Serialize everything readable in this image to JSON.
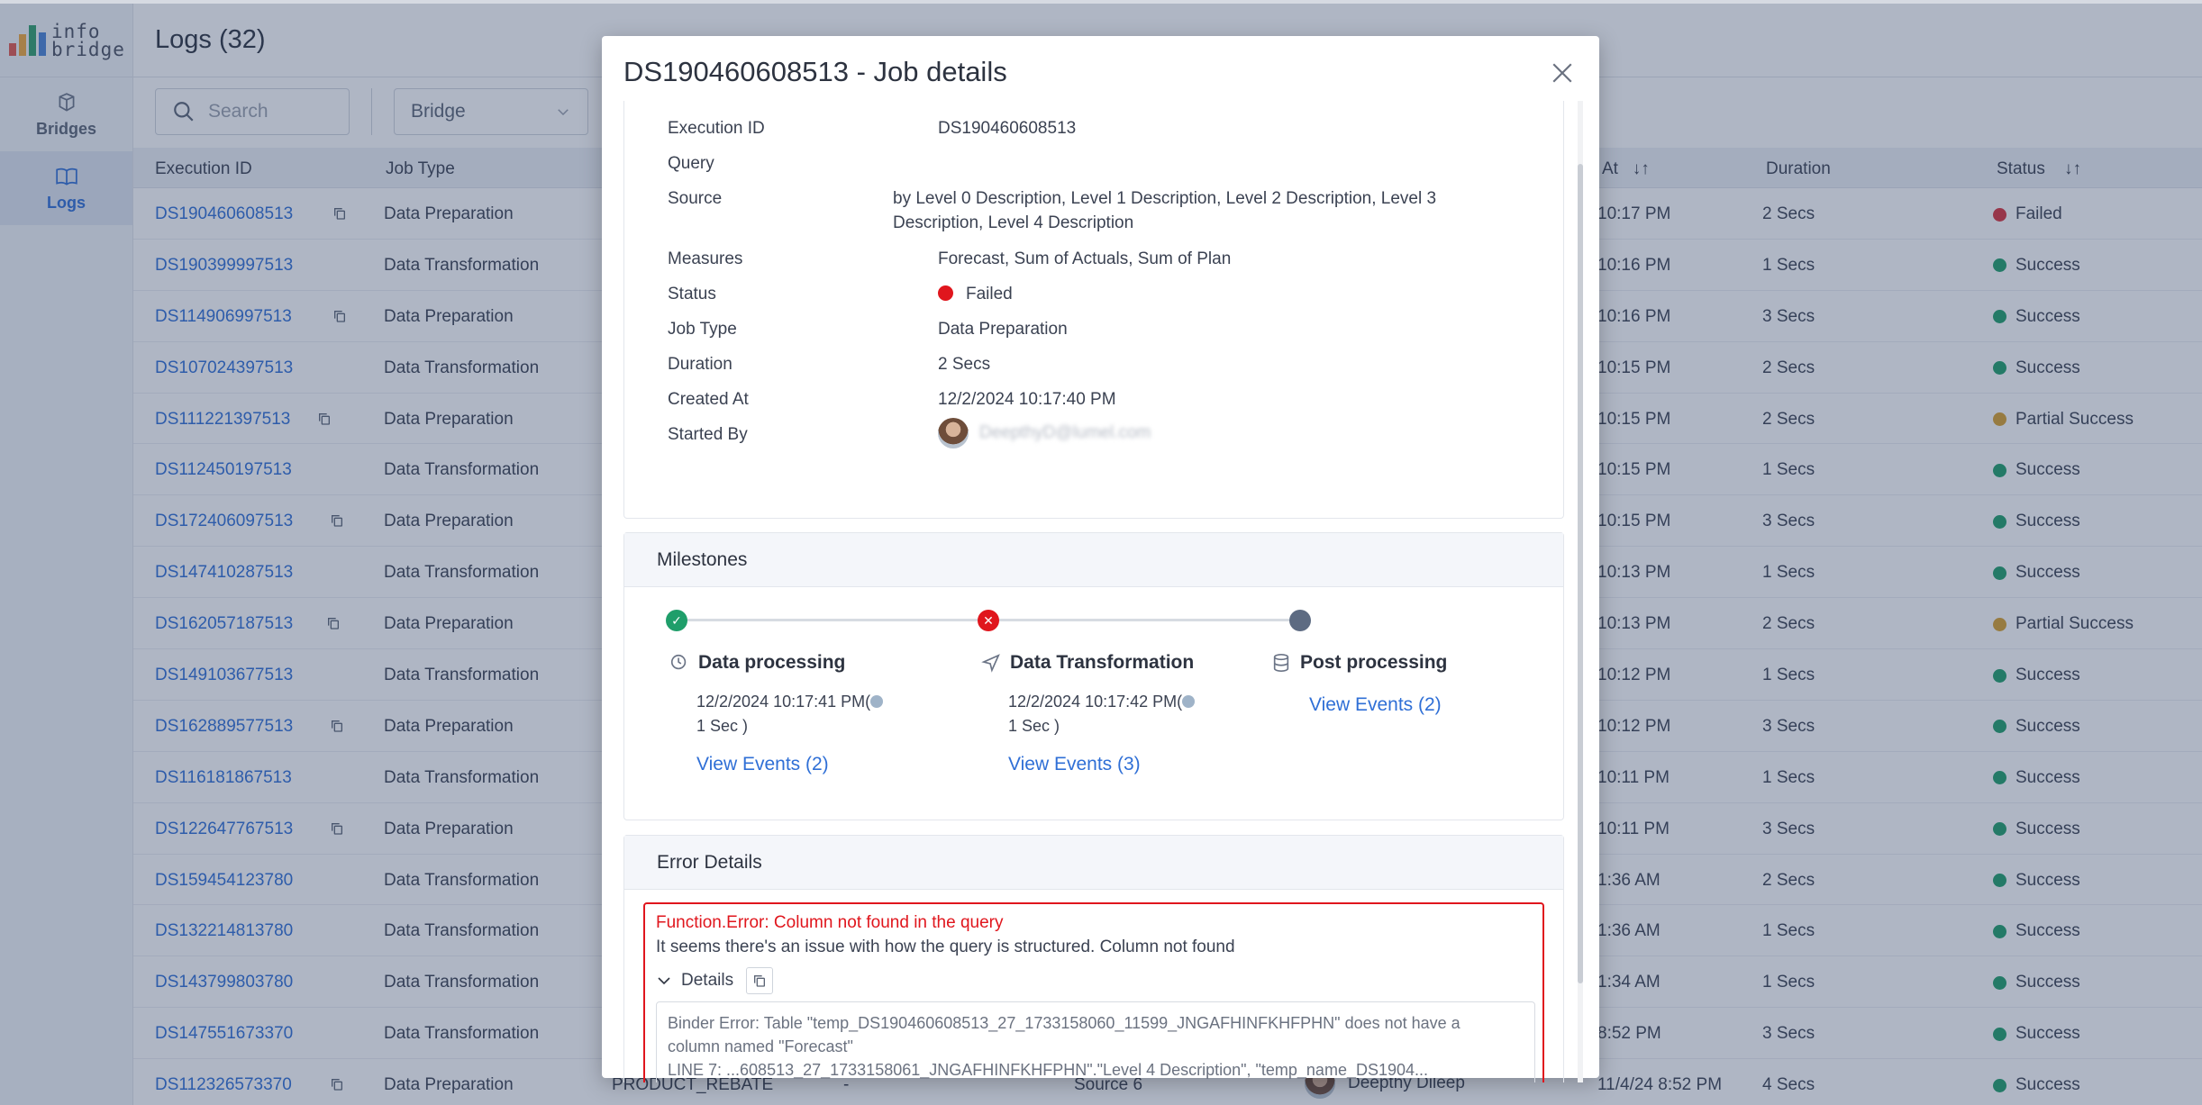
{
  "app": {
    "logo_text_1": "info",
    "logo_text_2": "bridge",
    "page_title": "Logs (32)"
  },
  "sidebar": {
    "items": [
      {
        "label": "Bridges",
        "icon": "bridges-icon",
        "active": false
      },
      {
        "label": "Logs",
        "icon": "book-icon",
        "active": true
      }
    ]
  },
  "toolbar": {
    "search_placeholder": "Search",
    "bridge_select": "Bridge"
  },
  "table": {
    "columns": {
      "execution_id": "Execution ID",
      "job_type": "Job Type",
      "created_at": "At",
      "duration": "Duration",
      "status": "Status"
    },
    "rows": [
      {
        "id": "DS190460608513",
        "copy": true,
        "type": "Data Preparation",
        "at": "10:17 PM",
        "duration": "2 Secs",
        "status": "Failed",
        "color": "#d9313a"
      },
      {
        "id": "DS190399997513",
        "copy": false,
        "type": "Data Transformation",
        "at": "10:16 PM",
        "duration": "1 Secs",
        "status": "Success",
        "color": "#1f9e6a"
      },
      {
        "id": "DS114906997513",
        "copy": true,
        "type": "Data Preparation",
        "at": "10:16 PM",
        "duration": "3 Secs",
        "status": "Success",
        "color": "#1f9e6a"
      },
      {
        "id": "DS107024397513",
        "copy": false,
        "type": "Data Transformation",
        "at": "10:15 PM",
        "duration": "2 Secs",
        "status": "Success",
        "color": "#1f9e6a"
      },
      {
        "id": "DS111221397513",
        "copy": true,
        "type": "Data Preparation",
        "at": "10:15 PM",
        "duration": "2 Secs",
        "status": "Partial Success",
        "color": "#d9a12c"
      },
      {
        "id": "DS112450197513",
        "copy": false,
        "type": "Data Transformation",
        "at": "10:15 PM",
        "duration": "1 Secs",
        "status": "Success",
        "color": "#1f9e6a"
      },
      {
        "id": "DS172406097513",
        "copy": true,
        "type": "Data Preparation",
        "at": "10:15 PM",
        "duration": "3 Secs",
        "status": "Success",
        "color": "#1f9e6a"
      },
      {
        "id": "DS147410287513",
        "copy": false,
        "type": "Data Transformation",
        "at": "10:13 PM",
        "duration": "1 Secs",
        "status": "Success",
        "color": "#1f9e6a"
      },
      {
        "id": "DS162057187513",
        "copy": true,
        "type": "Data Preparation",
        "at": "10:13 PM",
        "duration": "2 Secs",
        "status": "Partial Success",
        "color": "#d9a12c"
      },
      {
        "id": "DS149103677513",
        "copy": false,
        "type": "Data Transformation",
        "at": "10:12 PM",
        "duration": "1 Secs",
        "status": "Success",
        "color": "#1f9e6a"
      },
      {
        "id": "DS162889577513",
        "copy": true,
        "type": "Data Preparation",
        "at": "10:12 PM",
        "duration": "3 Secs",
        "status": "Success",
        "color": "#1f9e6a"
      },
      {
        "id": "DS116181867513",
        "copy": false,
        "type": "Data Transformation",
        "at": "10:11 PM",
        "duration": "1 Secs",
        "status": "Success",
        "color": "#1f9e6a"
      },
      {
        "id": "DS122647767513",
        "copy": true,
        "type": "Data Preparation",
        "at": "10:11 PM",
        "duration": "3 Secs",
        "status": "Success",
        "color": "#1f9e6a"
      },
      {
        "id": "DS159454123780",
        "copy": false,
        "type": "Data Transformation",
        "at": "1:36 AM",
        "duration": "2 Secs",
        "status": "Success",
        "color": "#1f9e6a"
      },
      {
        "id": "DS132214813780",
        "copy": false,
        "type": "Data Transformation",
        "at": "1:36 AM",
        "duration": "1 Secs",
        "status": "Success",
        "color": "#1f9e6a"
      },
      {
        "id": "DS143799803780",
        "copy": false,
        "type": "Data Transformation",
        "at": "1:34 AM",
        "duration": "1 Secs",
        "status": "Success",
        "color": "#1f9e6a"
      },
      {
        "id": "DS147551673370",
        "copy": false,
        "type": "Data Transformation",
        "at": "8:52 PM",
        "duration": "3 Secs",
        "status": "Success",
        "color": "#1f9e6a"
      },
      {
        "id": "DS112326573370",
        "copy": true,
        "type": "Data Preparation",
        "name": "PRODUCT_REBATE",
        "dash": "-",
        "source": "Source 6",
        "user": "Deepthy Dileep",
        "at": "11/4/24 8:52 PM",
        "duration": "4 Secs",
        "status": "Success",
        "color": "#1f9e6a"
      }
    ]
  },
  "modal": {
    "title": "DS190460608513 - Job details",
    "info": {
      "execution_id_label": "Execution ID",
      "execution_id_value": "DS190460608513",
      "query_label": "Query",
      "source_label": "Source",
      "source_line1": "by Level 0 Description, Level 1 Description, Level 2 Description, Level 3",
      "source_line2": "Description, Level 4 Description",
      "measures_label": "Measures",
      "measures_value": "Forecast, Sum of Actuals, Sum of Plan",
      "status_label": "Status",
      "status_value": "Failed",
      "job_type_label": "Job Type",
      "job_type_value": "Data Preparation",
      "duration_label": "Duration",
      "duration_value": "2 Secs",
      "created_at_label": "Created At",
      "created_at_value": "12/2/2024 10:17:40 PM",
      "started_by_label": "Started By",
      "started_by_value": "DeepthyD@lumel.com"
    },
    "milestones": {
      "heading": "Milestones",
      "steps": [
        {
          "title": "Data processing",
          "time1": "12/2/2024 10:17:41 PM(",
          "time2": "1 Sec )",
          "link": "View Events (2)",
          "state": "success"
        },
        {
          "title": "Data Transformation",
          "time1": "12/2/2024 10:17:42 PM(",
          "time2": "1 Sec )",
          "link": "View Events (3)",
          "state": "error"
        },
        {
          "title": "Post processing",
          "link": "View Events (2)",
          "state": "pending"
        }
      ]
    },
    "error": {
      "heading": "Error Details",
      "title": "Function.Error: Column not found in the query",
      "message": "It seems there's an issue with how the query is structured. Column not found",
      "details_label": "Details",
      "details_line1": "Binder Error: Table \"temp_DS190460608513_27_1733158060_11599_JNGAFHINFKHFPHN\" does not have a",
      "details_line2": "column named \"Forecast\"",
      "details_line3": "LINE 7: ...608513_27_1733158061_JNGAFHINFKHFPHN\".\"Level 4 Description\", \"temp_name_DS1904..."
    }
  }
}
